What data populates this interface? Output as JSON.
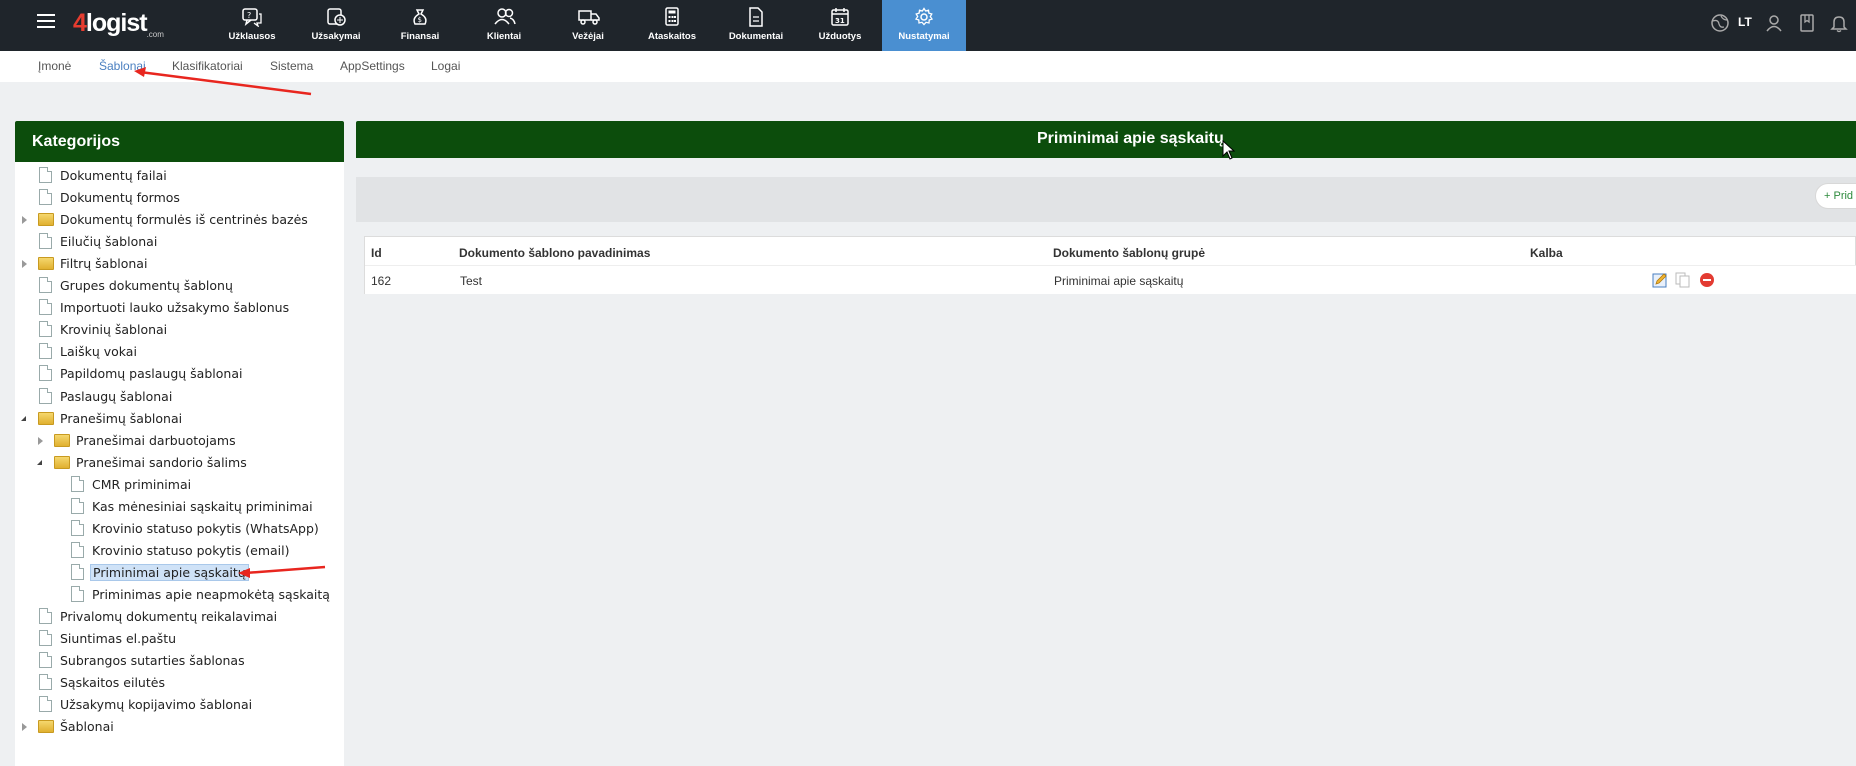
{
  "app": {
    "logo_main": "logist",
    "logo_num": "4",
    "logo_sub": ".com",
    "language": "LT"
  },
  "topnav": [
    {
      "label": "Užklausos",
      "icon": "inquiry-icon"
    },
    {
      "label": "Užsakymai",
      "icon": "orders-icon"
    },
    {
      "label": "Finansai",
      "icon": "money-bag-icon"
    },
    {
      "label": "Klientai",
      "icon": "users-icon"
    },
    {
      "label": "Vežėjai",
      "icon": "truck-icon"
    },
    {
      "label": "Ataskaitos",
      "icon": "calculator-icon"
    },
    {
      "label": "Dokumentai",
      "icon": "document-icon"
    },
    {
      "label": "Užduotys",
      "icon": "calendar-icon"
    },
    {
      "label": "Nustatymai",
      "icon": "gear-icon",
      "active": true
    }
  ],
  "subnav": [
    "Įmonė",
    "Šablonai",
    "Klasifikatoriai",
    "Sistema",
    "AppSettings",
    "Logai"
  ],
  "left": {
    "title": "Kategorijos",
    "tree": [
      {
        "label": "Dokumentų failai",
        "level": 0,
        "type": "file"
      },
      {
        "label": "Dokumentų formos",
        "level": 0,
        "type": "file"
      },
      {
        "label": "Dokumentų formulės iš centrinės bazės",
        "level": 0,
        "type": "folder",
        "state": "collapsed"
      },
      {
        "label": "Eilučių šablonai",
        "level": 0,
        "type": "file"
      },
      {
        "label": "Filtrų šablonai",
        "level": 0,
        "type": "folder",
        "state": "collapsed"
      },
      {
        "label": "Grupes dokumentų šablonų",
        "level": 0,
        "type": "file"
      },
      {
        "label": "Importuoti lauko užsakymo šablonus",
        "level": 0,
        "type": "file"
      },
      {
        "label": "Krovinių šablonai",
        "level": 0,
        "type": "file"
      },
      {
        "label": "Laiškų vokai",
        "level": 0,
        "type": "file"
      },
      {
        "label": "Papildomų paslaugų šablonai",
        "level": 0,
        "type": "file"
      },
      {
        "label": "Paslaugų šablonai",
        "level": 0,
        "type": "file"
      },
      {
        "label": "Pranešimų šablonai",
        "level": 0,
        "type": "folder",
        "state": "expanded"
      },
      {
        "label": "Pranešimai darbuotojams",
        "level": 1,
        "type": "folder",
        "state": "collapsed"
      },
      {
        "label": "Pranešimai sandorio šalims",
        "level": 1,
        "type": "folder",
        "state": "expanded"
      },
      {
        "label": "CMR priminimai",
        "level": 2,
        "type": "file"
      },
      {
        "label": "Kas mėnesiniai sąskaitų priminimai",
        "level": 2,
        "type": "file"
      },
      {
        "label": "Krovinio statuso pokytis (WhatsApp)",
        "level": 2,
        "type": "file"
      },
      {
        "label": "Krovinio statuso pokytis (email)",
        "level": 2,
        "type": "file"
      },
      {
        "label": "Priminimai apie sąskaitų",
        "level": 2,
        "type": "file",
        "selected": true
      },
      {
        "label": "Priminimas apie neapmokėtą sąskaitą",
        "level": 2,
        "type": "file"
      },
      {
        "label": "Privalomų dokumentų reikalavimai",
        "level": 0,
        "type": "file"
      },
      {
        "label": "Siuntimas el.paštu",
        "level": 0,
        "type": "file"
      },
      {
        "label": "Subrangos sutarties šablonas",
        "level": 0,
        "type": "file"
      },
      {
        "label": "Sąskaitos eilutės",
        "level": 0,
        "type": "file"
      },
      {
        "label": "Užsakymų kopijavimo šablonai",
        "level": 0,
        "type": "file"
      },
      {
        "label": "Šablonai",
        "level": 0,
        "type": "folder",
        "state": "collapsed"
      }
    ]
  },
  "right": {
    "title": "Priminimai apie sąskaitų",
    "add_label": "+ Prid",
    "columns": [
      "Id",
      "Dokumento šablono pavadinimas",
      "Dokumento šablonų grupė",
      "Kalba"
    ],
    "rows": [
      {
        "id": "162",
        "name": "Test",
        "group": "Priminimai apie sąskaitų",
        "lang": ""
      }
    ]
  },
  "colors": {
    "topbar": "#1f252b",
    "active_nav": "#4a8fd1",
    "panel_header": "#0c4d0c",
    "annotation_arrow": "#e8261f"
  }
}
